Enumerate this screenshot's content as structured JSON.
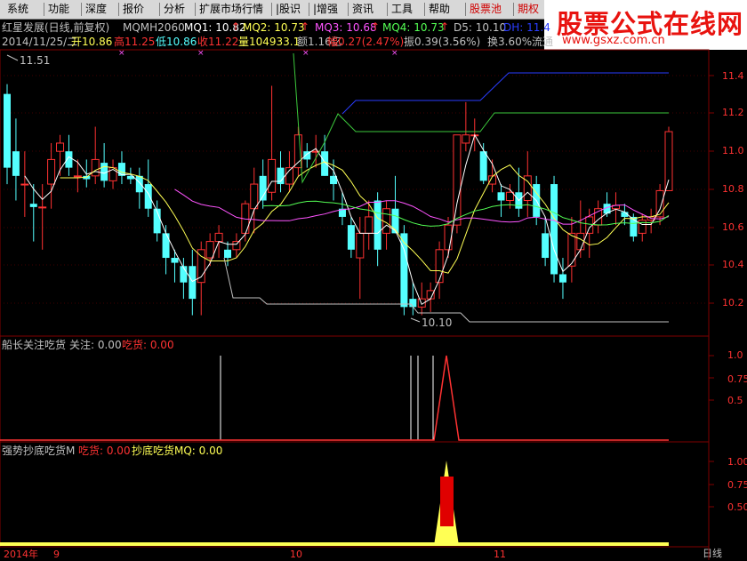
{
  "menu": [
    {
      "label": "系统"
    },
    {
      "label": "功能"
    },
    {
      "label": "深度"
    },
    {
      "label": "报价"
    },
    {
      "label": "分析"
    },
    {
      "label": "扩展市场行情"
    },
    {
      "label": "|股识"
    },
    {
      "label": "|增强"
    },
    {
      "label": "资讯"
    },
    {
      "label": "工具"
    },
    {
      "label": "帮助"
    },
    {
      "label": "股票池",
      "highlight": true
    },
    {
      "label": "期权",
      "highlight": true
    }
  ],
  "watermark": {
    "title": "股票公式在线网",
    "url": "www.gsxz.com.cn"
  },
  "stock_header": {
    "name": "红星发展(日线,前复权)",
    "indicator": "MQMH2060",
    "mq1": "MQ1: 10.82",
    "mq2": "MQ2: 10.73",
    "mq3": "MQ3: 10.68",
    "mq4": "MQ4: 10.73",
    "d5": "D5: 10.10",
    "dh": "DH: 11.4"
  },
  "quote_line": {
    "date": "2014/11/25/二",
    "open": "开10.86",
    "high": "高11.25",
    "low": "低10.86",
    "close": "收11.22",
    "volume": "量104933.1",
    "amount": "额1.16亿",
    "change": "幅0.27(2.47%)",
    "amplitude": "振0.39(3.56%)",
    "turnover": "换3.60%",
    "float": "流通"
  },
  "main_panel": {
    "max_label": "11.51",
    "min_label": "10.10",
    "y_ticks": [
      "11.4",
      "11.2",
      "11.0",
      "10.8",
      "10.6",
      "10.4",
      "10.2"
    ]
  },
  "sub_panel1": {
    "title": "船长关注吃货",
    "attention": "关注: 0.00",
    "buy": "吃货: 0.00",
    "y_ticks": [
      "1.0",
      "0.75",
      "0.5"
    ]
  },
  "sub_panel2": {
    "title": "强势抄底吃货M",
    "buy": "吃货: 0.00",
    "bottom": "抄底吃货MQ: 0.00",
    "y_ticks": [
      "1.00",
      "0.75",
      "0.50"
    ]
  },
  "x_axis": {
    "labels": [
      "2014年",
      "9",
      "10",
      "11"
    ],
    "period": "日线"
  },
  "colors": {
    "up": "#ff3232",
    "down": "#54ffff",
    "ma1": "#ffffff",
    "ma2": "#ffff54",
    "ma3": "#ff54ff",
    "ma4": "#54ff54",
    "blue_line": "#2a3dff",
    "green_step": "#3cc83c",
    "grid": "#800000"
  },
  "chart_data": {
    "type": "candlestick",
    "ylim": [
      10.0,
      11.6
    ],
    "candles": [
      {
        "o": 11.45,
        "h": 11.51,
        "l": 10.9,
        "c": 11.0
      },
      {
        "o": 11.1,
        "h": 11.3,
        "l": 10.8,
        "c": 10.95
      },
      {
        "o": 10.9,
        "h": 11.1,
        "l": 10.7,
        "c": 10.9
      },
      {
        "o": 10.78,
        "h": 10.9,
        "l": 10.55,
        "c": 10.76
      },
      {
        "o": 10.76,
        "h": 10.9,
        "l": 10.5,
        "c": 10.76
      },
      {
        "o": 10.9,
        "h": 11.15,
        "l": 10.75,
        "c": 11.05
      },
      {
        "o": 11.1,
        "h": 11.2,
        "l": 10.95,
        "c": 11.15
      },
      {
        "o": 11.1,
        "h": 11.2,
        "l": 10.95,
        "c": 11.0
      },
      {
        "o": 10.95,
        "h": 11.05,
        "l": 10.85,
        "c": 10.95
      },
      {
        "o": 10.95,
        "h": 11.05,
        "l": 10.88,
        "c": 10.93
      },
      {
        "o": 10.95,
        "h": 11.25,
        "l": 10.9,
        "c": 11.05
      },
      {
        "o": 11.03,
        "h": 11.15,
        "l": 10.88,
        "c": 10.92
      },
      {
        "o": 10.92,
        "h": 11.05,
        "l": 10.87,
        "c": 11.0
      },
      {
        "o": 11.03,
        "h": 11.1,
        "l": 10.9,
        "c": 10.95
      },
      {
        "o": 10.95,
        "h": 11.0,
        "l": 10.9,
        "c": 10.93
      },
      {
        "o": 10.95,
        "h": 11.0,
        "l": 10.75,
        "c": 10.85
      },
      {
        "o": 10.9,
        "h": 11.05,
        "l": 10.7,
        "c": 10.75
      },
      {
        "o": 10.75,
        "h": 10.8,
        "l": 10.55,
        "c": 10.6
      },
      {
        "o": 10.6,
        "h": 10.65,
        "l": 10.35,
        "c": 10.45
      },
      {
        "o": 10.45,
        "h": 10.5,
        "l": 10.3,
        "c": 10.42
      },
      {
        "o": 10.4,
        "h": 10.45,
        "l": 10.2,
        "c": 10.3
      },
      {
        "o": 10.4,
        "h": 10.5,
        "l": 10.1,
        "c": 10.2
      },
      {
        "o": 10.3,
        "h": 10.55,
        "l": 10.1,
        "c": 10.5
      },
      {
        "o": 10.45,
        "h": 10.6,
        "l": 10.4,
        "c": 10.55
      },
      {
        "o": 10.55,
        "h": 10.65,
        "l": 10.45,
        "c": 10.6
      },
      {
        "o": 10.5,
        "h": 10.55,
        "l": 10.4,
        "c": 10.45
      },
      {
        "o": 10.5,
        "h": 10.6,
        "l": 10.45,
        "c": 10.55
      },
      {
        "o": 10.6,
        "h": 10.8,
        "l": 10.55,
        "c": 10.78
      },
      {
        "o": 10.75,
        "h": 11.0,
        "l": 10.6,
        "c": 10.9
      },
      {
        "o": 10.95,
        "h": 11.05,
        "l": 10.75,
        "c": 10.8
      },
      {
        "o": 10.85,
        "h": 11.5,
        "l": 10.8,
        "c": 11.05
      },
      {
        "o": 11.0,
        "h": 11.1,
        "l": 10.85,
        "c": 10.9
      },
      {
        "o": 10.9,
        "h": 11.1,
        "l": 10.85,
        "c": 11.0
      },
      {
        "o": 11.0,
        "h": 11.25,
        "l": 10.95,
        "c": 11.2
      },
      {
        "o": 11.1,
        "h": 11.15,
        "l": 11.0,
        "c": 11.05
      },
      {
        "o": 11.1,
        "h": 11.2,
        "l": 11.0,
        "c": 11.1
      },
      {
        "o": 11.1,
        "h": 11.2,
        "l": 10.95,
        "c": 10.95
      },
      {
        "o": 10.95,
        "h": 11.05,
        "l": 10.8,
        "c": 10.9
      },
      {
        "o": 10.75,
        "h": 10.85,
        "l": 10.65,
        "c": 10.7
      },
      {
        "o": 10.65,
        "h": 10.7,
        "l": 10.45,
        "c": 10.5
      },
      {
        "o": 10.45,
        "h": 10.7,
        "l": 10.2,
        "c": 10.6
      },
      {
        "o": 10.6,
        "h": 10.8,
        "l": 10.5,
        "c": 10.7
      },
      {
        "o": 10.8,
        "h": 10.85,
        "l": 10.4,
        "c": 10.5
      },
      {
        "o": 10.6,
        "h": 10.8,
        "l": 10.5,
        "c": 10.75
      },
      {
        "o": 10.75,
        "h": 10.95,
        "l": 10.6,
        "c": 10.6
      },
      {
        "o": 10.6,
        "h": 10.65,
        "l": 10.1,
        "c": 10.15
      },
      {
        "o": 10.2,
        "h": 10.3,
        "l": 10.1,
        "c": 10.15
      },
      {
        "o": 10.15,
        "h": 10.3,
        "l": 10.1,
        "c": 10.2
      },
      {
        "o": 10.2,
        "h": 10.3,
        "l": 10.12,
        "c": 10.25
      },
      {
        "o": 10.3,
        "h": 10.55,
        "l": 10.2,
        "c": 10.5
      },
      {
        "o": 10.5,
        "h": 10.7,
        "l": 10.45,
        "c": 10.65
      },
      {
        "o": 10.65,
        "h": 11.2,
        "l": 10.6,
        "c": 11.2
      },
      {
        "o": 11.15,
        "h": 11.4,
        "l": 11.1,
        "c": 11.2
      },
      {
        "o": 11.2,
        "h": 11.3,
        "l": 11.1,
        "c": 11.2
      },
      {
        "o": 11.1,
        "h": 11.15,
        "l": 10.9,
        "c": 10.92
      },
      {
        "o": 10.9,
        "h": 11.05,
        "l": 10.85,
        "c": 10.95
      },
      {
        "o": 10.85,
        "h": 10.9,
        "l": 10.7,
        "c": 10.8
      },
      {
        "o": 10.8,
        "h": 10.9,
        "l": 10.75,
        "c": 10.85
      },
      {
        "o": 10.85,
        "h": 11.0,
        "l": 10.7,
        "c": 10.75
      },
      {
        "o": 10.8,
        "h": 11.1,
        "l": 10.7,
        "c": 10.95
      },
      {
        "o": 10.9,
        "h": 10.95,
        "l": 10.65,
        "c": 10.7
      },
      {
        "o": 10.6,
        "h": 10.7,
        "l": 10.4,
        "c": 10.45
      },
      {
        "o": 10.9,
        "h": 10.95,
        "l": 10.3,
        "c": 10.35
      },
      {
        "o": 10.35,
        "h": 10.45,
        "l": 10.2,
        "c": 10.3
      },
      {
        "o": 10.4,
        "h": 10.7,
        "l": 10.3,
        "c": 10.6
      },
      {
        "o": 10.5,
        "h": 10.8,
        "l": 10.45,
        "c": 10.6
      },
      {
        "o": 10.6,
        "h": 10.75,
        "l": 10.45,
        "c": 10.7
      },
      {
        "o": 10.65,
        "h": 10.8,
        "l": 10.6,
        "c": 10.75
      },
      {
        "o": 10.78,
        "h": 10.85,
        "l": 10.7,
        "c": 10.72
      },
      {
        "o": 10.75,
        "h": 10.85,
        "l": 10.65,
        "c": 10.77
      },
      {
        "o": 10.73,
        "h": 10.78,
        "l": 10.65,
        "c": 10.7
      },
      {
        "o": 10.7,
        "h": 10.72,
        "l": 10.55,
        "c": 10.58
      },
      {
        "o": 10.6,
        "h": 10.72,
        "l": 10.55,
        "c": 10.68
      },
      {
        "o": 10.68,
        "h": 10.75,
        "l": 10.6,
        "c": 10.7
      },
      {
        "o": 10.7,
        "h": 10.9,
        "l": 10.65,
        "c": 10.86
      },
      {
        "o": 10.86,
        "h": 11.25,
        "l": 10.86,
        "c": 11.22
      }
    ],
    "sub1_spikes": [
      0.0
    ],
    "sub2_peak": 1.0
  }
}
